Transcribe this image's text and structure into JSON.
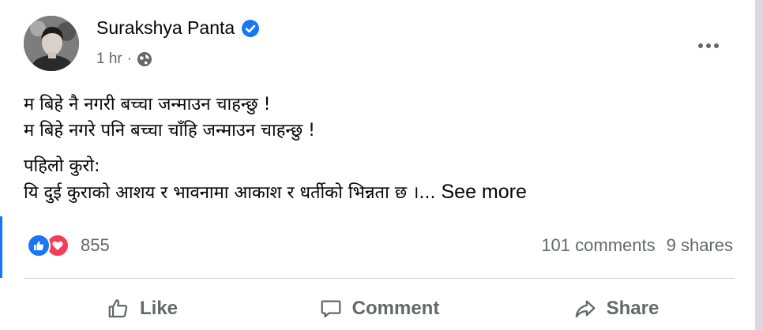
{
  "post": {
    "author": "Surakshya Panta",
    "time": "1 hr",
    "separator": "·",
    "lines1": [
      "म बिहे नै नगरी बच्चा जन्माउन चाहन्छु !",
      "म बिहे नगरे पनि बच्चा चाँहि जन्माउन चाहन्छु !"
    ],
    "lines2_first": "पहिलो कुरो:",
    "lines2_second": "यि दुई कुराको आशय र भावनामा आकाश र धर्तीको भिन्नता छ ।...",
    "see_more": "See more"
  },
  "stats": {
    "reactions_count": "855",
    "comments": "101 comments",
    "shares": "9 shares"
  },
  "actions": {
    "like": "Like",
    "comment": "Comment",
    "share": "Share"
  },
  "icons": {
    "verified": "verified-badge-icon",
    "audience": "globe-icon",
    "more": "more-options-icon",
    "like_reaction": "like-reaction-icon",
    "love_reaction": "love-reaction-icon"
  },
  "colors": {
    "accent": "#1877f2",
    "love": "#f33e58",
    "secondary_text": "#65676b",
    "primary_text": "#050505"
  }
}
